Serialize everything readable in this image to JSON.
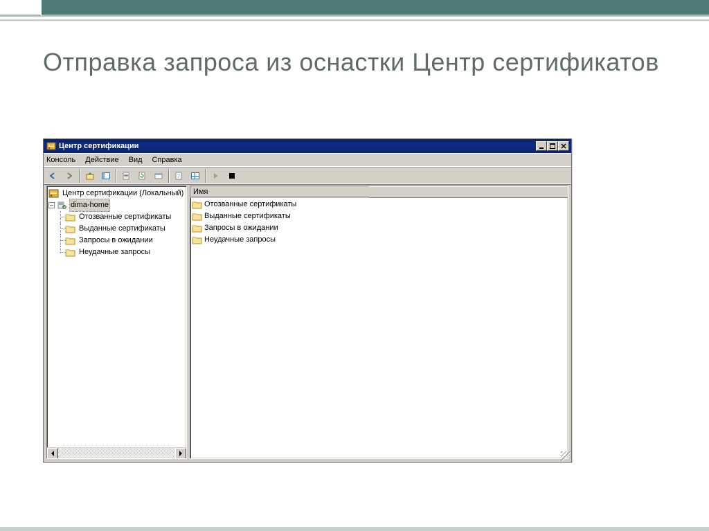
{
  "slide": {
    "title": "Отправка запроса из оснастки Центр сертификатов"
  },
  "window": {
    "title": "Центр сертификации",
    "menus": {
      "console": "Консоль",
      "action": "Действие",
      "view": "Вид",
      "help": "Справка"
    },
    "left_pane": {
      "root_label": "Центр сертификации (Локальный)",
      "ca_node": "dima-home",
      "items": [
        "Отозванные сертификаты",
        "Выданные сертификаты",
        "Запросы в ожидании",
        "Неудачные запросы"
      ]
    },
    "right_pane": {
      "column_header": "Имя",
      "items": [
        "Отозванные сертификаты",
        "Выданные сертификаты",
        "Запросы в ожидании",
        "Неудачные запросы"
      ]
    }
  }
}
